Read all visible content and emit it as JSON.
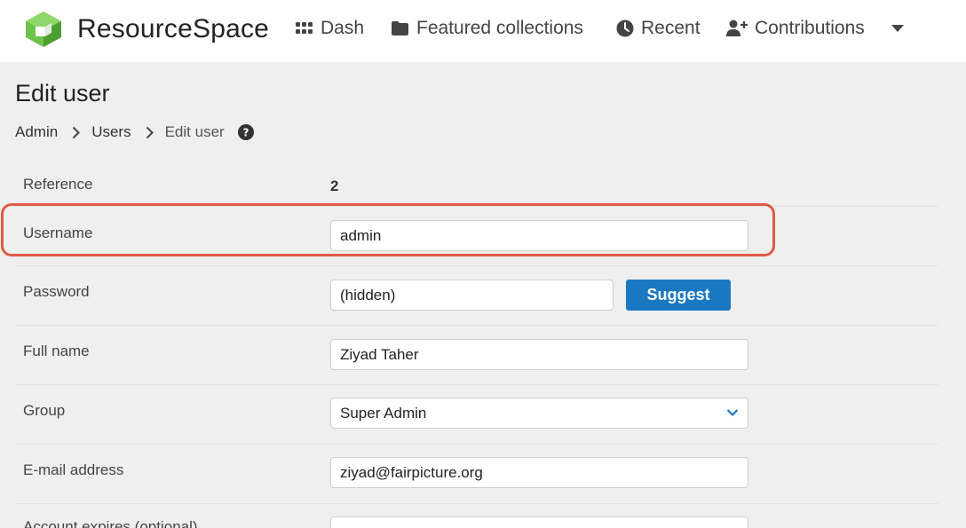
{
  "header": {
    "brand_bold": "Resource",
    "brand_light": "Space",
    "nav": {
      "dash": "Dash",
      "featured": "Featured collections",
      "recent": "Recent",
      "contributions": "Contributions"
    }
  },
  "page": {
    "title": "Edit user",
    "breadcrumb": [
      "Admin",
      "Users",
      "Edit user"
    ]
  },
  "form": {
    "reference_label": "Reference",
    "reference_value": "2",
    "username_label": "Username",
    "username_value": "admin",
    "password_label": "Password",
    "password_value": "(hidden)",
    "suggest_label": "Suggest",
    "fullname_label": "Full name",
    "fullname_value": "Ziyad Taher",
    "group_label": "Group",
    "group_value": "Super Admin",
    "email_label": "E-mail address",
    "email_value": "ziyad@fairpicture.org",
    "expires_label": "Account expires (optional)"
  },
  "colors": {
    "accent": "#1a78c2",
    "highlight": "#e05a44",
    "logo_green": "#6cc24a"
  }
}
